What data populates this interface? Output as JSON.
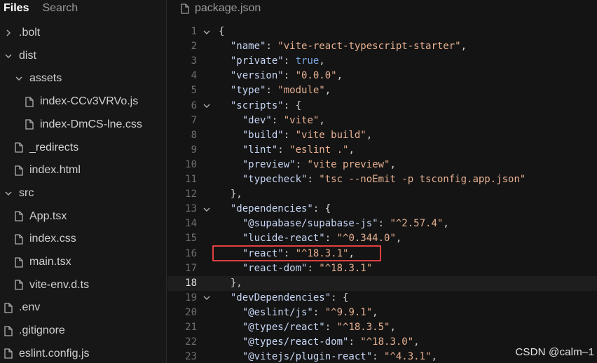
{
  "sidebar": {
    "tabs": [
      {
        "label": "Files",
        "active": true
      },
      {
        "label": "Search",
        "active": false
      }
    ],
    "tree": [
      {
        "name": ".bolt",
        "kind": "folder",
        "expanded": false,
        "depth": 0
      },
      {
        "name": "dist",
        "kind": "folder",
        "expanded": true,
        "depth": 0
      },
      {
        "name": "assets",
        "kind": "folder",
        "expanded": true,
        "depth": 1
      },
      {
        "name": "index-CCv3VRVo.js",
        "kind": "file",
        "depth": 2
      },
      {
        "name": "index-DmCS-lne.css",
        "kind": "file",
        "depth": 2
      },
      {
        "name": "_redirects",
        "kind": "file",
        "depth": 1
      },
      {
        "name": "index.html",
        "kind": "file",
        "depth": 1
      },
      {
        "name": "src",
        "kind": "folder",
        "expanded": true,
        "depth": 0
      },
      {
        "name": "App.tsx",
        "kind": "file",
        "depth": 1
      },
      {
        "name": "index.css",
        "kind": "file",
        "depth": 1
      },
      {
        "name": "main.tsx",
        "kind": "file",
        "depth": 1
      },
      {
        "name": "vite-env.d.ts",
        "kind": "file",
        "depth": 1
      },
      {
        "name": ".env",
        "kind": "file",
        "depth": 0
      },
      {
        "name": ".gitignore",
        "kind": "file",
        "depth": 0
      },
      {
        "name": "eslint.config.js",
        "kind": "file",
        "depth": 0
      }
    ]
  },
  "editor": {
    "tab_label": "package.json",
    "current_line": 18,
    "lines": [
      {
        "n": 1,
        "fold": true,
        "t": [
          [
            "p",
            "{"
          ]
        ]
      },
      {
        "n": 2,
        "t": [
          [
            "p",
            "  "
          ],
          [
            "k",
            "\"name\""
          ],
          [
            "p",
            ": "
          ],
          [
            "s",
            "\"vite-react-typescript-starter\""
          ],
          [
            "p",
            ","
          ]
        ]
      },
      {
        "n": 3,
        "t": [
          [
            "p",
            "  "
          ],
          [
            "k",
            "\"private\""
          ],
          [
            "p",
            ": "
          ],
          [
            "b",
            "true"
          ],
          [
            "p",
            ","
          ]
        ]
      },
      {
        "n": 4,
        "t": [
          [
            "p",
            "  "
          ],
          [
            "k",
            "\"version\""
          ],
          [
            "p",
            ": "
          ],
          [
            "s",
            "\"0.0.0\""
          ],
          [
            "p",
            ","
          ]
        ]
      },
      {
        "n": 5,
        "t": [
          [
            "p",
            "  "
          ],
          [
            "k",
            "\"type\""
          ],
          [
            "p",
            ": "
          ],
          [
            "s",
            "\"module\""
          ],
          [
            "p",
            ","
          ]
        ]
      },
      {
        "n": 6,
        "fold": true,
        "t": [
          [
            "p",
            "  "
          ],
          [
            "k",
            "\"scripts\""
          ],
          [
            "p",
            ": {"
          ]
        ]
      },
      {
        "n": 7,
        "t": [
          [
            "p",
            "    "
          ],
          [
            "k",
            "\"dev\""
          ],
          [
            "p",
            ": "
          ],
          [
            "s",
            "\"vite\""
          ],
          [
            "p",
            ","
          ]
        ]
      },
      {
        "n": 8,
        "t": [
          [
            "p",
            "    "
          ],
          [
            "k",
            "\"build\""
          ],
          [
            "p",
            ": "
          ],
          [
            "s",
            "\"vite build\""
          ],
          [
            "p",
            ","
          ]
        ]
      },
      {
        "n": 9,
        "t": [
          [
            "p",
            "    "
          ],
          [
            "k",
            "\"lint\""
          ],
          [
            "p",
            ": "
          ],
          [
            "s",
            "\"eslint .\""
          ],
          [
            "p",
            ","
          ]
        ]
      },
      {
        "n": 10,
        "t": [
          [
            "p",
            "    "
          ],
          [
            "k",
            "\"preview\""
          ],
          [
            "p",
            ": "
          ],
          [
            "s",
            "\"vite preview\""
          ],
          [
            "p",
            ","
          ]
        ]
      },
      {
        "n": 11,
        "t": [
          [
            "p",
            "    "
          ],
          [
            "k",
            "\"typecheck\""
          ],
          [
            "p",
            ": "
          ],
          [
            "s",
            "\"tsc --noEmit -p tsconfig.app.json\""
          ]
        ]
      },
      {
        "n": 12,
        "t": [
          [
            "p",
            "  },"
          ]
        ]
      },
      {
        "n": 13,
        "fold": true,
        "t": [
          [
            "p",
            "  "
          ],
          [
            "k",
            "\"dependencies\""
          ],
          [
            "p",
            ": {"
          ]
        ]
      },
      {
        "n": 14,
        "t": [
          [
            "p",
            "    "
          ],
          [
            "k",
            "\"@supabase/supabase-js\""
          ],
          [
            "p",
            ": "
          ],
          [
            "s",
            "\"^2.57.4\""
          ],
          [
            "p",
            ","
          ]
        ]
      },
      {
        "n": 15,
        "t": [
          [
            "p",
            "    "
          ],
          [
            "k",
            "\"lucide-react\""
          ],
          [
            "p",
            ": "
          ],
          [
            "s",
            "\"^0.344.0\""
          ],
          [
            "p",
            ","
          ]
        ]
      },
      {
        "n": 16,
        "t": [
          [
            "p",
            "    "
          ],
          [
            "k",
            "\"react\""
          ],
          [
            "p",
            ": "
          ],
          [
            "s",
            "\"^18.3.1\""
          ],
          [
            "p",
            ","
          ]
        ]
      },
      {
        "n": 17,
        "t": [
          [
            "p",
            "    "
          ],
          [
            "k",
            "\"react-dom\""
          ],
          [
            "p",
            ": "
          ],
          [
            "s",
            "\"^18.3.1\""
          ]
        ]
      },
      {
        "n": 18,
        "t": [
          [
            "p",
            "  },"
          ]
        ]
      },
      {
        "n": 19,
        "fold": true,
        "t": [
          [
            "p",
            "  "
          ],
          [
            "k",
            "\"devDependencies\""
          ],
          [
            "p",
            ": {"
          ]
        ]
      },
      {
        "n": 20,
        "t": [
          [
            "p",
            "    "
          ],
          [
            "k",
            "\"@eslint/js\""
          ],
          [
            "p",
            ": "
          ],
          [
            "s",
            "\"^9.9.1\""
          ],
          [
            "p",
            ","
          ]
        ]
      },
      {
        "n": 21,
        "t": [
          [
            "p",
            "    "
          ],
          [
            "k",
            "\"@types/react\""
          ],
          [
            "p",
            ": "
          ],
          [
            "s",
            "\"^18.3.5\""
          ],
          [
            "p",
            ","
          ]
        ]
      },
      {
        "n": 22,
        "t": [
          [
            "p",
            "    "
          ],
          [
            "k",
            "\"@types/react-dom\""
          ],
          [
            "p",
            ": "
          ],
          [
            "s",
            "\"^18.3.0\""
          ],
          [
            "p",
            ","
          ]
        ]
      },
      {
        "n": 23,
        "t": [
          [
            "p",
            "    "
          ],
          [
            "k",
            "\"@vitejs/plugin-react\""
          ],
          [
            "p",
            ": "
          ],
          [
            "s",
            "\"^4.3.1\""
          ],
          [
            "p",
            ","
          ]
        ]
      }
    ]
  },
  "annotation": {
    "color": "#e04040",
    "target_line": 16
  },
  "watermark": "CSDN @calm–1",
  "colors": {
    "key": "#c7d6f5",
    "string": "#e8b091",
    "boolean": "#7aa6e0",
    "punct": "#d4d4d4",
    "line_number": "#6f6f6f"
  }
}
